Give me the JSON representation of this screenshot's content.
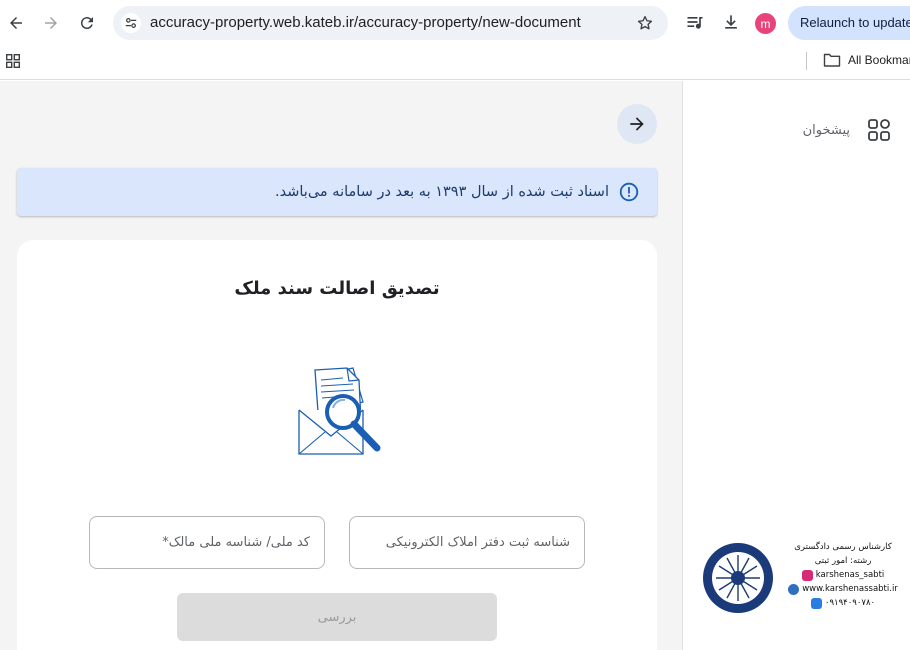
{
  "browser": {
    "url": "accuracy-property.web.kateb.ir/accuracy-property/new-document",
    "relaunch_label": "Relaunch to update",
    "avatar_letter": "m",
    "bookmarks_label": "All Bookmarks"
  },
  "sidebar": {
    "dashboard_label": "پیشخوان"
  },
  "alert": {
    "text": "اسناد ثبت شده از سال ۱۳۹۳ به بعد در سامانه می‌باشد."
  },
  "form": {
    "title": "تصدیق اصالت سند ملک",
    "registry_id_placeholder": "شناسه ثبت دفتر املاک الکترونیکی",
    "national_id_placeholder": "کد ملی/ شناسه ملی مالک*",
    "submit_label": "بررسی"
  },
  "watermark": {
    "line1": "کارشناس رسمی دادگستری",
    "line2": "رشته: امور ثبتی",
    "instagram": "karshenas_sabti",
    "website": "www.karshenassabti.ir",
    "phone": "۰۹۱۹۴۰۹۰۷۸۰"
  },
  "colors": {
    "alert_bg": "#d9e6fb",
    "accent_blue": "#1a5fb4",
    "avatar": "#e8437b"
  }
}
